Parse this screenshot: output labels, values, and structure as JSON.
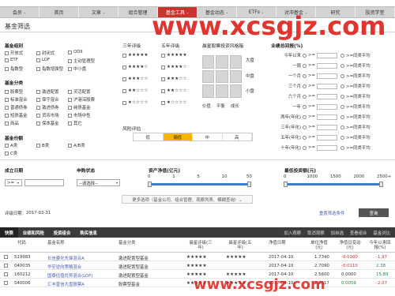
{
  "nav": [
    {
      "label": "会员",
      "arrow": "⌄"
    },
    {
      "label": "首页",
      "arrow": ""
    },
    {
      "label": "文章",
      "arrow": "⌄"
    },
    {
      "label": "组合管理",
      "arrow": ""
    },
    {
      "label": "基金工具",
      "arrow": "⌄"
    },
    {
      "label": "基金动态",
      "arrow": "⌄"
    },
    {
      "label": "ETFs",
      "arrow": "⌄"
    },
    {
      "label": "对冲基金",
      "arrow": "⌄"
    },
    {
      "label": "研究",
      "arrow": ""
    },
    {
      "label": "投资学堂",
      "arrow": ""
    }
  ],
  "page_title": "基金筛选",
  "fund_group": {
    "title": "基金组别",
    "items": [
      "开放式",
      "封闭式",
      "QDII",
      "ETF",
      "LOF",
      "主动管理型",
      "指数型",
      "指数增强型",
      "中小盘"
    ]
  },
  "fund_category": {
    "title": "基金分类",
    "items": [
      "股票型",
      "激进配置",
      "灵活配置",
      "标准混合",
      "保守混合",
      "沪港深股票",
      "普通债券",
      "激进债券",
      "纯债基金",
      "短债基金",
      "货币市场",
      "市场中性",
      "商品",
      "保本基金",
      "其它"
    ]
  },
  "fund_rating_ab": {
    "title": "基金份额",
    "items": [
      "A类",
      "B类",
      "A/B类",
      "C类"
    ]
  },
  "ratings": {
    "three_year": "三年评级",
    "five_year": "五年评级",
    "stars": [
      "★★★★★",
      "★★★★",
      "★★★",
      "★★",
      "★"
    ]
  },
  "style_box": {
    "title": "晨星股票投资风格箱",
    "row_labels": [
      "大盘",
      "中盘",
      "小盘"
    ],
    "col_labels": [
      "价值",
      "平衡",
      "成长"
    ]
  },
  "risk": {
    "title": "风险评估",
    "levels": [
      "低",
      "偏低",
      "中",
      "高"
    ],
    "selected": "偏低"
  },
  "perf": {
    "title": "业绩总回报(%)",
    "rows": [
      "今年以来",
      "一周",
      "一个月",
      "三个月",
      "六个月",
      "一年",
      "两年(年化)",
      "三年(年化)",
      "五年(年化)",
      "十年(年化)"
    ],
    "gte": ">=",
    "avg_label": "同类平均"
  },
  "inception": {
    "title": "成立日期",
    "op": ">=",
    "placeholder": ""
  },
  "purchase": {
    "title": "申购状态",
    "value": "--请选择--"
  },
  "assets": {
    "title": "资产净值(亿元)",
    "ticks": [
      "0",
      "1",
      "5",
      "10",
      "50"
    ]
  },
  "min_invest": {
    "title": "最低投资额(元)",
    "ticks": [
      "0",
      "1000",
      "1500",
      "2000",
      "2500+"
    ]
  },
  "more_options": "更多选项（基金公司、组合管理、观察列表、模糊查询）⌄",
  "rating_date_label": "评级日期：",
  "rating_date": "2017-03-31",
  "save_filter": "重置筛选条件",
  "query": "查询",
  "tabs": [
    "快照",
    "业绩和风险",
    "投资组合",
    "购买信息"
  ],
  "tab_tools": [
    "加入观察",
    "取消观察",
    "加自选",
    "查看组合",
    "基金对比"
  ],
  "table": {
    "headers": {
      "code": "代码",
      "name": "基金名称",
      "category": "基金分类",
      "rating3": "晨星评级(三年)",
      "rating5": "晨星评级(五年)",
      "nav_date": "净值日期",
      "nav": "单位净值(元)",
      "nav_change": "净值日变动(元)",
      "ytd": "今年以来回报(%)"
    },
    "rows": [
      {
        "code": "519983",
        "name": "长信量化先锋混合A",
        "category": "激进配置型基金",
        "r3": "★★★★★",
        "r5": "★★★★★",
        "date": "2017-04-10",
        "nav": "1.7340",
        "chg": "-0.0100",
        "ytd": "-1.97"
      },
      {
        "code": "040035",
        "name": "华安逆向策略混合",
        "category": "激进配置型基金",
        "r3": "★★★★★",
        "r5": "",
        "date": "2017-04-10",
        "nav": "2.7090",
        "chg": "-0.0110",
        "ytd": "2.38"
      },
      {
        "code": "160212",
        "name": "国泰估值优势混合(LOF)",
        "category": "激进配置型基金",
        "r3": "★★★★★",
        "r5": "★★★★★",
        "date": "2017-04-10",
        "nav": "2.5600",
        "chg": "0.0000",
        "ytd": "15.89"
      },
      {
        "code": "540006",
        "name": "汇丰晋信大盘股票A",
        "category": "股票型基金",
        "r3": "★★★★★",
        "r5": "★★★★★",
        "date": "2017-04-10",
        "nav": "2.8517",
        "chg": "0.0059",
        "ytd": "-2.07"
      }
    ]
  },
  "watermarks": [
    "www.xcsgjz.com",
    "www.xcsgjz.com"
  ],
  "colors": {
    "brand": "#c8342e",
    "selected": "#f5b500",
    "dark_tab": "#3b3b3b"
  }
}
